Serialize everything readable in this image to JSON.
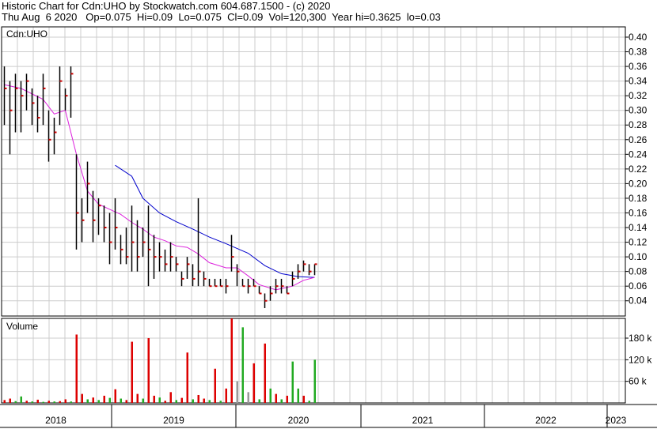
{
  "header": {
    "line1": "Historic Chart for Cdn:UHO by Stockwatch.com 604.687.1500 - (c) 2020",
    "line2": "Thu Aug  6 2020   Op=0.075  Hi=0.09  Lo=0.075  Cl=0.09  Vol=120,300  Year hi=0.3625  lo=0.03"
  },
  "chart_data": [
    {
      "type": "line",
      "panel_label": "Cdn:UHO",
      "y_ticks": [
        "0.40",
        "0.38",
        "0.36",
        "0.34",
        "0.32",
        "0.30",
        "0.28",
        "0.26",
        "0.24",
        "0.22",
        "0.20",
        "0.18",
        "0.16",
        "0.14",
        "0.12",
        "0.10",
        "0.08",
        "0.06",
        "0.04"
      ],
      "ylim": [
        0.02,
        0.42
      ],
      "x_labels": [
        "2018",
        "2019",
        "2020",
        "2021",
        "2022",
        "2023"
      ],
      "grid": true,
      "colors": {
        "price": "#000000",
        "close_tick": "#cc0000",
        "ma_short": "#dd22dd",
        "ma_long": "#0000cc",
        "grid": "#cccccc"
      },
      "bars": [
        [
          0.5,
          0.28,
          0.36,
          0.33
        ],
        [
          1.5,
          0.24,
          0.34,
          0.3
        ],
        [
          2.5,
          0.27,
          0.35,
          0.33
        ],
        [
          3.5,
          0.27,
          0.34,
          0.32
        ],
        [
          4.5,
          0.3,
          0.35,
          0.34
        ],
        [
          5.5,
          0.28,
          0.33,
          0.31
        ],
        [
          6.5,
          0.27,
          0.32,
          0.29
        ],
        [
          7.5,
          0.28,
          0.35,
          0.33
        ],
        [
          8.5,
          0.23,
          0.3,
          0.26
        ],
        [
          9.5,
          0.24,
          0.29,
          0.27
        ],
        [
          10.5,
          0.28,
          0.36,
          0.34
        ],
        [
          11.5,
          0.3,
          0.33,
          0.32
        ],
        [
          12.5,
          0.29,
          0.36,
          0.35
        ],
        [
          13.5,
          0.11,
          0.24,
          0.16
        ],
        [
          14.5,
          0.12,
          0.18,
          0.15
        ],
        [
          15.5,
          0.16,
          0.23,
          0.2
        ],
        [
          16.5,
          0.12,
          0.19,
          0.15
        ],
        [
          17.5,
          0.13,
          0.18,
          0.17
        ],
        [
          18.5,
          0.12,
          0.17,
          0.14
        ],
        [
          19.5,
          0.09,
          0.16,
          0.12
        ],
        [
          20.5,
          0.11,
          0.18,
          0.14
        ],
        [
          21.5,
          0.09,
          0.13,
          0.11
        ],
        [
          22.5,
          0.09,
          0.14,
          0.1
        ],
        [
          23.5,
          0.08,
          0.17,
          0.12
        ],
        [
          24.5,
          0.08,
          0.15,
          0.1
        ],
        [
          25.5,
          0.1,
          0.14,
          0.12
        ],
        [
          26.5,
          0.06,
          0.17,
          0.11
        ],
        [
          27.5,
          0.07,
          0.13,
          0.1
        ],
        [
          28.5,
          0.08,
          0.12,
          0.1
        ],
        [
          29.5,
          0.08,
          0.11,
          0.09
        ],
        [
          30.5,
          0.08,
          0.12,
          0.1
        ],
        [
          31.5,
          0.08,
          0.1,
          0.09
        ],
        [
          32.5,
          0.06,
          0.08,
          0.07
        ],
        [
          33.5,
          0.07,
          0.1,
          0.09
        ],
        [
          34.5,
          0.06,
          0.09,
          0.07
        ],
        [
          35.5,
          0.06,
          0.18,
          0.08
        ],
        [
          36.5,
          0.06,
          0.08,
          0.07
        ],
        [
          37.5,
          0.06,
          0.07,
          0.06
        ],
        [
          38.5,
          0.06,
          0.07,
          0.06
        ],
        [
          39.5,
          0.06,
          0.07,
          0.06
        ],
        [
          40.5,
          0.05,
          0.07,
          0.06
        ],
        [
          41.5,
          0.08,
          0.13,
          0.1
        ],
        [
          42.5,
          0.06,
          0.09,
          0.08
        ],
        [
          43.5,
          0.06,
          0.07,
          0.06
        ],
        [
          44.5,
          0.05,
          0.07,
          0.06
        ],
        [
          45.5,
          0.06,
          0.07,
          0.06
        ],
        [
          46.5,
          0.05,
          0.06,
          0.05
        ],
        [
          47.5,
          0.03,
          0.05,
          0.04
        ],
        [
          48.5,
          0.04,
          0.06,
          0.05
        ],
        [
          49.5,
          0.05,
          0.07,
          0.06
        ],
        [
          50.5,
          0.05,
          0.07,
          0.06
        ],
        [
          51.5,
          0.05,
          0.06,
          0.05
        ],
        [
          52.5,
          0.06,
          0.08,
          0.07
        ],
        [
          53.5,
          0.07,
          0.09,
          0.08
        ],
        [
          54.5,
          0.08,
          0.095,
          0.09
        ],
        [
          55.5,
          0.075,
          0.09,
          0.08
        ],
        [
          56.5,
          0.075,
          0.09,
          0.09
        ]
      ],
      "ma_short": [
        [
          0.5,
          0.335
        ],
        [
          3.5,
          0.33
        ],
        [
          7.5,
          0.315
        ],
        [
          9.5,
          0.295
        ],
        [
          11.5,
          0.3
        ],
        [
          13.5,
          0.24
        ],
        [
          15.5,
          0.19
        ],
        [
          17.5,
          0.172
        ],
        [
          19.5,
          0.165
        ],
        [
          21.5,
          0.158
        ],
        [
          23.5,
          0.147
        ],
        [
          25.5,
          0.138
        ],
        [
          27.5,
          0.127
        ],
        [
          29.5,
          0.122
        ],
        [
          31.5,
          0.115
        ],
        [
          33.5,
          0.113
        ],
        [
          35.5,
          0.104
        ],
        [
          37.5,
          0.092
        ],
        [
          40.5,
          0.085
        ],
        [
          42.5,
          0.085
        ],
        [
          44.5,
          0.074
        ],
        [
          46.5,
          0.062
        ],
        [
          49.5,
          0.055
        ],
        [
          52.5,
          0.06
        ],
        [
          54.5,
          0.068
        ],
        [
          56.5,
          0.072
        ]
      ],
      "ma_long": [
        [
          20.5,
          0.225
        ],
        [
          23.5,
          0.21
        ],
        [
          25.5,
          0.18
        ],
        [
          28.5,
          0.16
        ],
        [
          31.5,
          0.148
        ],
        [
          34.5,
          0.138
        ],
        [
          37.5,
          0.127
        ],
        [
          40.5,
          0.118
        ],
        [
          44.5,
          0.105
        ],
        [
          47.5,
          0.088
        ],
        [
          50.5,
          0.077
        ],
        [
          53.5,
          0.073
        ],
        [
          56.5,
          0.072
        ]
      ],
      "x_domain": [
        0,
        80
      ]
    },
    {
      "type": "bar",
      "panel_label": "Volume",
      "y_ticks": [
        "180 k",
        "120 k",
        "60 k"
      ],
      "ylim": [
        0,
        230
      ],
      "colors": {
        "up": "#22aa22",
        "down": "#dd0000",
        "flat": "#999999"
      },
      "volumes": [
        [
          0.5,
          8,
          "d"
        ],
        [
          1.5,
          12,
          "d"
        ],
        [
          2.5,
          5,
          "u"
        ],
        [
          3.5,
          18,
          "u"
        ],
        [
          4.5,
          6,
          "d"
        ],
        [
          5.5,
          4,
          "u"
        ],
        [
          6.5,
          9,
          "d"
        ],
        [
          7.5,
          3,
          "u"
        ],
        [
          8.5,
          6,
          "d"
        ],
        [
          9.5,
          4,
          "u"
        ],
        [
          10.5,
          5,
          "d"
        ],
        [
          11.5,
          10,
          "d"
        ],
        [
          12.5,
          4,
          "u"
        ],
        [
          13.5,
          190,
          "d"
        ],
        [
          14.5,
          25,
          "d"
        ],
        [
          15.5,
          10,
          "u"
        ],
        [
          16.5,
          15,
          "d"
        ],
        [
          17.5,
          8,
          "u"
        ],
        [
          18.5,
          20,
          "d"
        ],
        [
          19.5,
          14,
          "u"
        ],
        [
          20.5,
          38,
          "d"
        ],
        [
          21.5,
          12,
          "u"
        ],
        [
          22.5,
          8,
          "d"
        ],
        [
          23.5,
          170,
          "d"
        ],
        [
          24.5,
          25,
          "d"
        ],
        [
          25.5,
          12,
          "u"
        ],
        [
          26.5,
          180,
          "d"
        ],
        [
          27.5,
          20,
          "d"
        ],
        [
          28.5,
          15,
          "u"
        ],
        [
          29.5,
          6,
          "d"
        ],
        [
          30.5,
          30,
          "d"
        ],
        [
          31.5,
          8,
          "u"
        ],
        [
          32.5,
          14,
          "d"
        ],
        [
          33.5,
          140,
          "d"
        ],
        [
          34.5,
          10,
          "u"
        ],
        [
          35.5,
          22,
          "d"
        ],
        [
          36.5,
          12,
          "d"
        ],
        [
          37.5,
          8,
          "u"
        ],
        [
          38.5,
          95,
          "d"
        ],
        [
          39.5,
          6,
          "u"
        ],
        [
          40.5,
          40,
          "d"
        ],
        [
          41.5,
          250,
          "d"
        ],
        [
          42.5,
          60,
          "f"
        ],
        [
          43.5,
          210,
          "u"
        ],
        [
          44.5,
          30,
          "f"
        ],
        [
          45.5,
          110,
          "d"
        ],
        [
          46.5,
          10,
          "u"
        ],
        [
          47.5,
          165,
          "d"
        ],
        [
          48.5,
          40,
          "u"
        ],
        [
          49.5,
          25,
          "d"
        ],
        [
          50.5,
          10,
          "u"
        ],
        [
          51.5,
          20,
          "d"
        ],
        [
          52.5,
          115,
          "u"
        ],
        [
          53.5,
          40,
          "u"
        ],
        [
          54.5,
          20,
          "d"
        ],
        [
          55.5,
          6,
          "u"
        ],
        [
          56.5,
          120,
          "u"
        ]
      ]
    }
  ]
}
